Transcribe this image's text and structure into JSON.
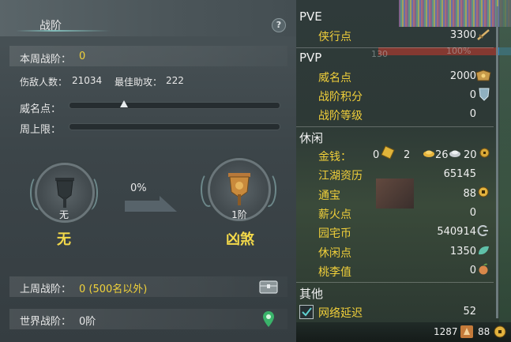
{
  "left_panel": {
    "title": "战阶",
    "help_label": "?",
    "weekly_rank": {
      "label": "本周战阶：",
      "value": "0"
    },
    "kills": {
      "label": "伤敌人数：",
      "value": "21034"
    },
    "best_assist": {
      "label": "最佳助攻：",
      "value": "222"
    },
    "prestige_label": "威名点：",
    "weekly_cap_label": "周上限：",
    "current_tier": {
      "caption": "无",
      "name": "无"
    },
    "progress_percent": "0%",
    "next_tier": {
      "caption": "1阶",
      "name": "凶煞"
    },
    "last_week": {
      "label": "上周战阶：",
      "value": "0 (500名以外)"
    },
    "world": {
      "label": "世界战阶：",
      "value": "0阶"
    }
  },
  "right_panel": {
    "sections": {
      "pve": "PVE",
      "pvp": "PVP",
      "leisure": "休闲",
      "other": "其他"
    },
    "stats": {
      "xiaxing": {
        "label": "侠行点",
        "value": "3300"
      },
      "weiming": {
        "label": "威名点",
        "value": "2000"
      },
      "zhanjie_jifen": {
        "label": "战阶积分",
        "value": "0"
      },
      "zhanjie_dengji": {
        "label": "战阶等级",
        "value": "0"
      },
      "money_label": "金钱：",
      "money_a": "0",
      "money_b": "2",
      "money_c": "26",
      "money_d": "20",
      "jianghu": {
        "label": "江湖资历",
        "value": "65145"
      },
      "tongbao": {
        "label": "通宝",
        "value": "88"
      },
      "xinhuo": {
        "label": "薪火点",
        "value": "0"
      },
      "yuanzhai": {
        "label": "园宅币",
        "value": "540914"
      },
      "xiuxian": {
        "label": "休闲点",
        "value": "1350"
      },
      "taoli": {
        "label": "桃李值",
        "value": "0"
      },
      "latency": {
        "label": "网络延迟",
        "value": "52"
      }
    },
    "faded_level": "130",
    "faded_percent": "100%",
    "bottom_level": "1287",
    "bottom_coins": "88"
  },
  "colors": {
    "accent_yellow": "#f1d23a",
    "panel_bg": "#3c4549"
  }
}
